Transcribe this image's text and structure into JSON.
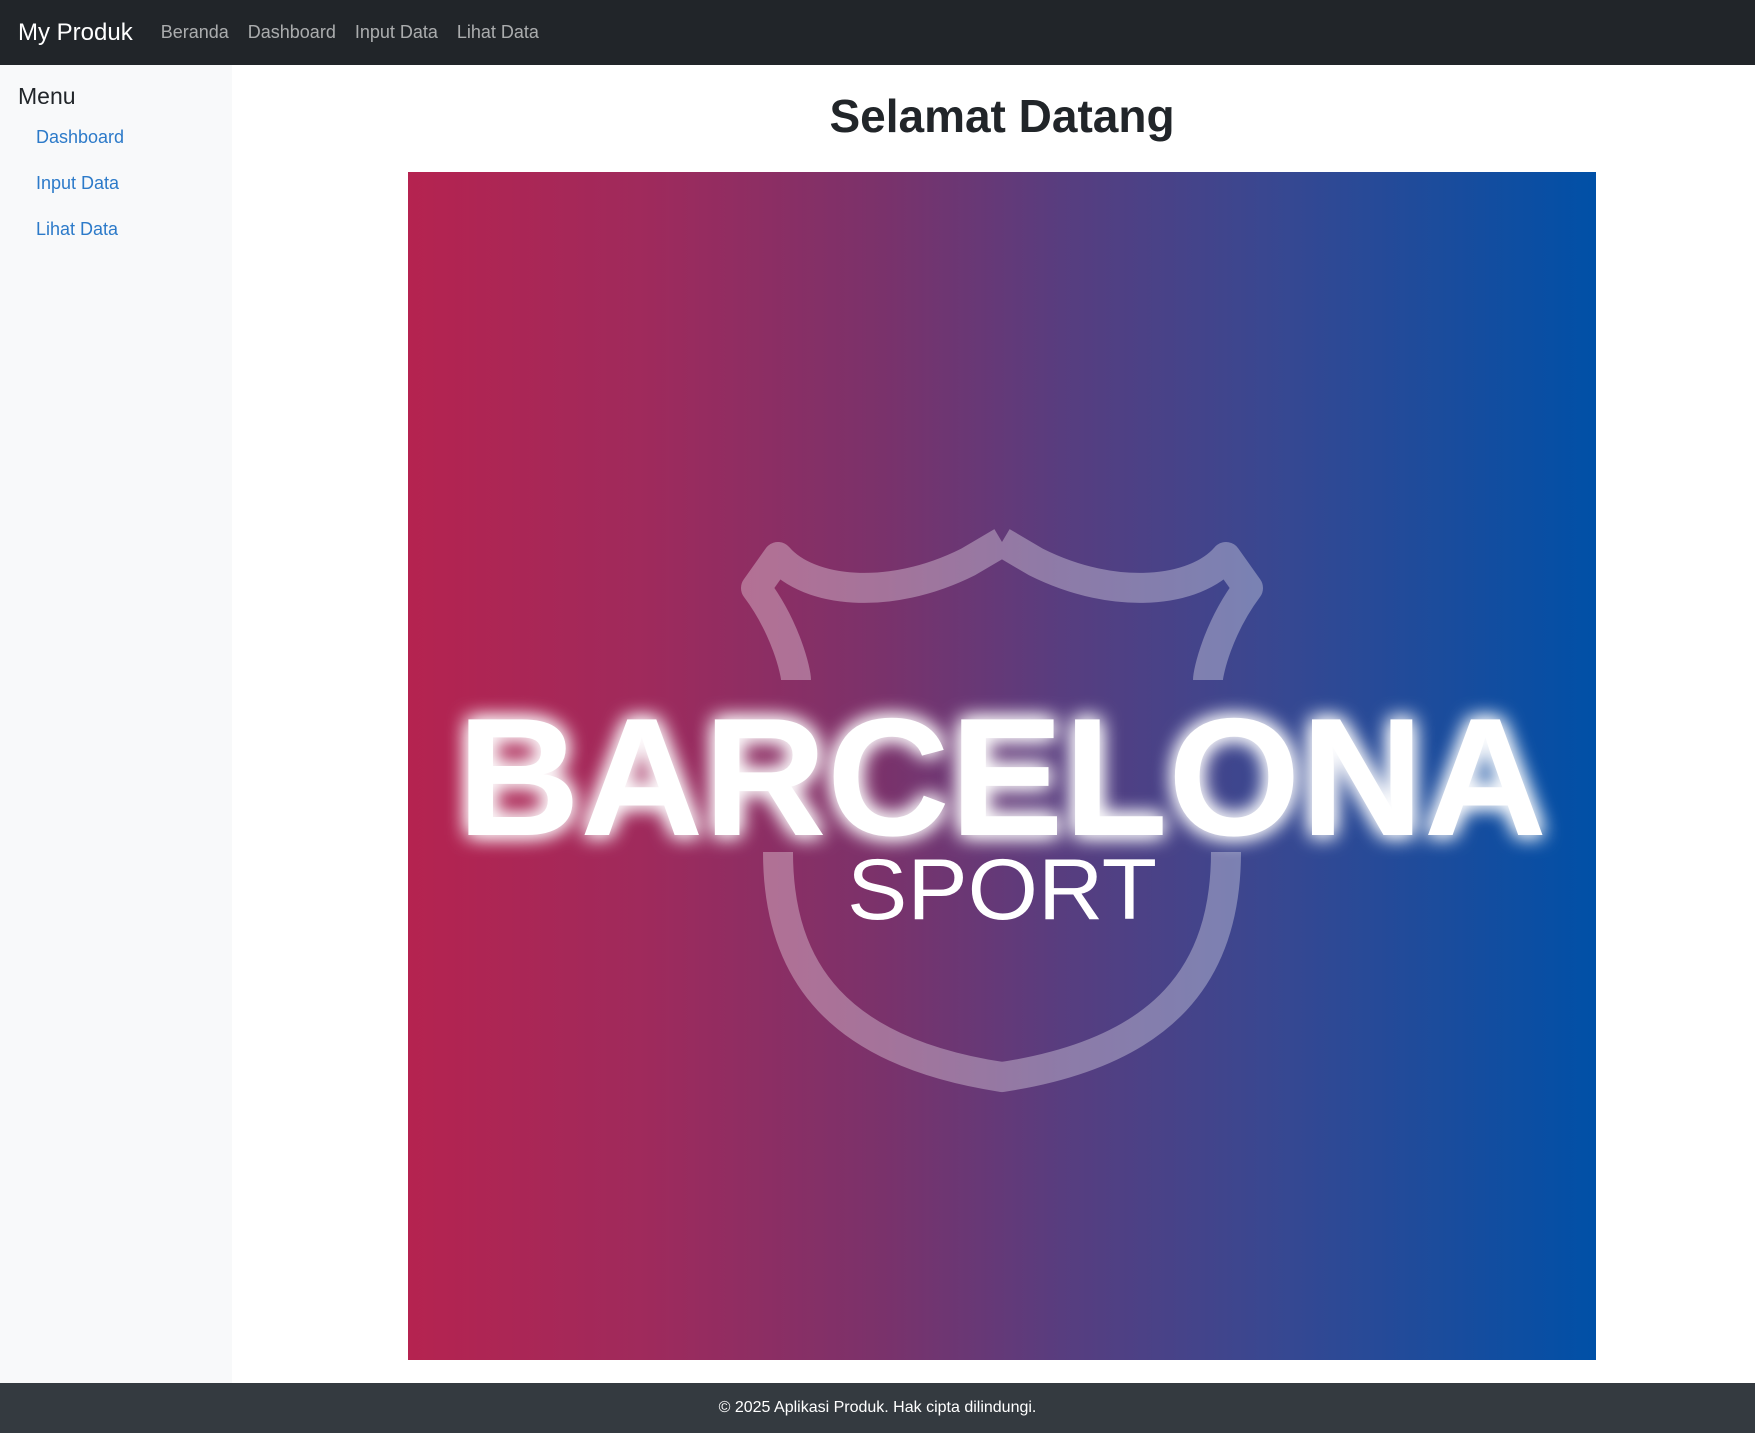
{
  "navbar": {
    "brand": "My Produk",
    "links": [
      "Beranda",
      "Dashboard",
      "Input Data",
      "Lihat Data"
    ]
  },
  "sidebar": {
    "title": "Menu",
    "items": [
      "Dashboard",
      "Input Data",
      "Lihat Data"
    ]
  },
  "main": {
    "title": "Selamat Datang",
    "banner": {
      "logo_text": "BARCELONA",
      "logo_subtext": "SPORT",
      "gradient_colors": [
        "#b52350",
        "#0050a7"
      ]
    }
  },
  "footer": {
    "text": "© 2025 Aplikasi Produk. Hak cipta dilindungi."
  },
  "colors": {
    "navbar_bg": "#212529",
    "sidebar_bg": "#f8f9fa",
    "link": "#2c7ac9",
    "footer_bg": "#343a40"
  }
}
